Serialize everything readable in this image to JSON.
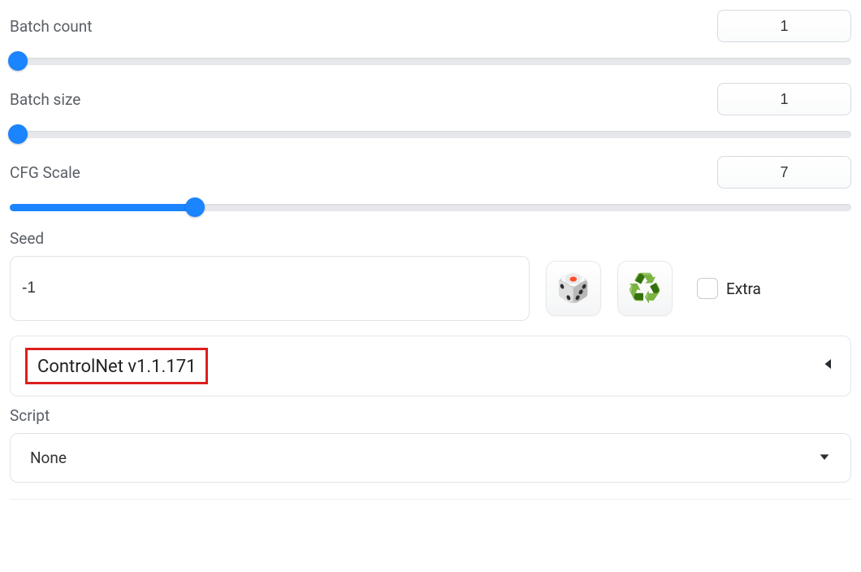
{
  "batchCount": {
    "label": "Batch count",
    "value": "1",
    "sliderPct": 1
  },
  "batchSize": {
    "label": "Batch size",
    "value": "1",
    "sliderPct": 1
  },
  "cfgScale": {
    "label": "CFG Scale",
    "value": "7",
    "sliderPct": 22
  },
  "seed": {
    "label": "Seed",
    "value": "-1",
    "extraLabel": "Extra",
    "extraChecked": false,
    "diceIcon": "🎲",
    "recycleIcon": "♻️"
  },
  "accordion": {
    "title": "ControlNet v1.1.171"
  },
  "script": {
    "label": "Script",
    "selected": "None"
  }
}
